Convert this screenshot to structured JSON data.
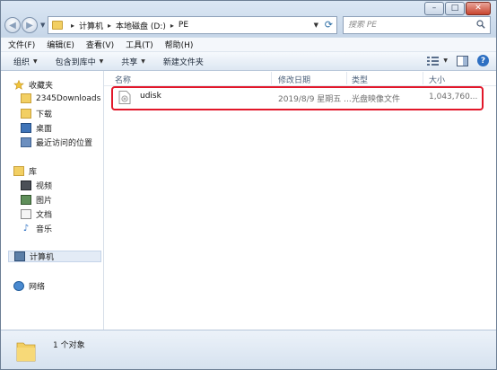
{
  "window": {
    "controls": {
      "minimize": "–",
      "maximize": "□",
      "close": "✕"
    }
  },
  "address": {
    "crumbs": [
      "计算机",
      "本地磁盘 (D:)",
      "PE"
    ],
    "separator": "▸"
  },
  "search": {
    "placeholder": "搜索 PE"
  },
  "menu": {
    "items": [
      "文件(F)",
      "编辑(E)",
      "查看(V)",
      "工具(T)",
      "帮助(H)"
    ]
  },
  "toolbar": {
    "organize": "组织",
    "include_in_library": "包含到库中",
    "share": "共享",
    "new_folder": "新建文件夹",
    "icons": [
      "view-options-icon",
      "preview-pane-icon",
      "help-icon"
    ]
  },
  "navpane": {
    "favorites": "收藏夹",
    "favorites_items": [
      "2345Downloads",
      "下载",
      "桌面",
      "最近访问的位置"
    ],
    "libraries": "库",
    "libraries_items": [
      "视频",
      "图片",
      "文档",
      "音乐"
    ],
    "computer": "计算机",
    "network": "网络"
  },
  "columns": {
    "name": "名称",
    "modified": "修改日期",
    "type": "类型",
    "size": "大小"
  },
  "files": [
    {
      "name": "udisk",
      "modified": "2019/8/9 星期五 ...",
      "type": "光盘映像文件",
      "size": "1,043,760..."
    }
  ],
  "details": {
    "count": "1 个对象"
  },
  "colors": {
    "highlight_border": "#e2172a",
    "folder_yellow": "#f2cf63",
    "accent_blue": "#2d6fc2"
  }
}
